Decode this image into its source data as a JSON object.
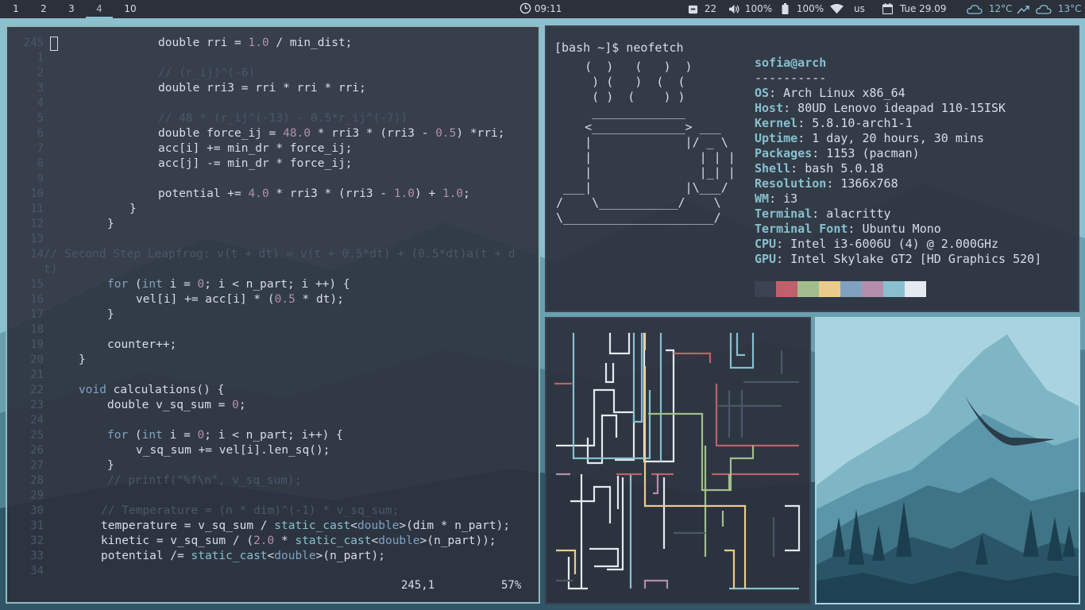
{
  "bar": {
    "workspaces": [
      "1",
      "2",
      "3",
      "4",
      "10"
    ],
    "active_workspace": "4",
    "clock": "09:11",
    "updates": "22",
    "volume": "100%",
    "battery": "100%",
    "keyboard": "us",
    "date": "Tue 29.09",
    "weather1": "12°C",
    "weather2": "13°C",
    "icons": [
      "clock-icon",
      "package-icon",
      "volume-icon",
      "battery-icon",
      "wifi-icon",
      "calendar-icon",
      "cloud-icon",
      "trend-icon",
      "cloud-icon"
    ]
  },
  "editor": {
    "line_numbers": [
      "245",
      "1",
      "2",
      "3",
      "4",
      "5",
      "6",
      "7",
      "8",
      "9",
      "10",
      "11",
      "12",
      "13",
      "14",
      "",
      "15",
      "16",
      "17",
      "18",
      "19",
      "20",
      "21",
      "22",
      "23",
      "24",
      "25",
      "26",
      "27",
      "28",
      "29",
      "30",
      "31",
      "32",
      "33",
      "34"
    ],
    "position": "245,1",
    "percent": "57%"
  },
  "terminal": {
    "prompt": "[bash ~]$ neofetch",
    "user": "sofia@arch",
    "separator": "----------",
    "fields": [
      {
        "key": "OS",
        "value": ": Arch Linux x86_64"
      },
      {
        "key": "Host",
        "value": ": 80UD Lenovo ideapad 110-15ISK"
      },
      {
        "key": "Kernel",
        "value": ": 5.8.10-arch1-1"
      },
      {
        "key": "Uptime",
        "value": ": 1 day, 20 hours, 30 mins"
      },
      {
        "key": "Packages",
        "value": ": 1153 (pacman)"
      },
      {
        "key": "Shell",
        "value": ": bash 5.0.18"
      },
      {
        "key": "Resolution",
        "value": ": 1366x768"
      },
      {
        "key": "WM",
        "value": ": i3"
      },
      {
        "key": "Terminal",
        "value": ": alacritty"
      },
      {
        "key": "Terminal Font",
        "value": ": Ubuntu Mono"
      },
      {
        "key": "CPU",
        "value": ": Intel i3-6006U (4) @ 2.000GHz"
      },
      {
        "key": "GPU",
        "value": ": Intel Skylake GT2 [HD Graphics 520]"
      }
    ],
    "palette": [
      "#3b4252",
      "#bf616a",
      "#a3be8c",
      "#ebcb8b",
      "#81a1c1",
      "#b48ead",
      "#88c0d0",
      "#e5e9f0"
    ],
    "ascii": "    (  )   (   )  )\n     ) (   )  (  (\n     ( )  (    ) )\n     _____________\n    <_____________> ___\n    |             |/ _ \\\n    |               | | |\n    |               |_| |\n ___|             |\\___/\n/    \\___________/    \\\n\\_____________________/"
  },
  "colors": {
    "accent": "#88c0d0",
    "bar_bg": "#2b303b",
    "window_bg": "#2e3440",
    "focused_border": "#8fbcbb"
  }
}
